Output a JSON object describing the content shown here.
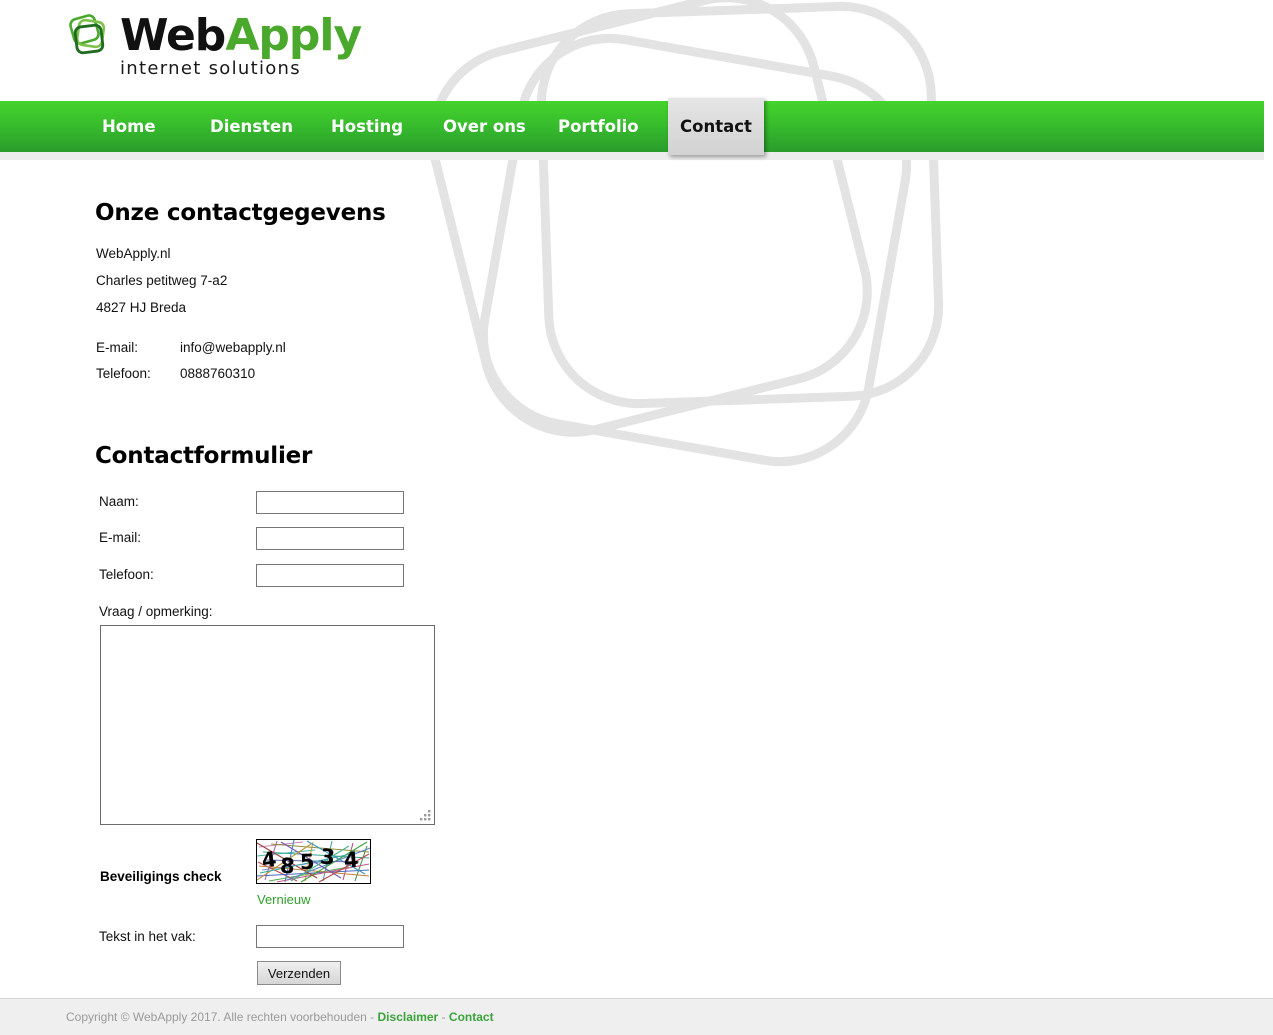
{
  "site": {
    "logo_text_part1": "Web",
    "logo_text_part2": "Apply",
    "logo_tagline": "internet solutions",
    "brand_green": "#4aa82c",
    "nav_green_top": "#44d32c",
    "nav_green_bottom": "#2a9c2c"
  },
  "nav": {
    "items": [
      {
        "label": "Home",
        "active": false
      },
      {
        "label": "Diensten",
        "active": false
      },
      {
        "label": "Hosting",
        "active": false
      },
      {
        "label": "Over ons",
        "active": false
      },
      {
        "label": "Portfolio",
        "active": false
      }
    ],
    "active_tab": "Contact"
  },
  "contact": {
    "heading": "Onze contactgegevens",
    "address_lines": [
      "WebApply.nl",
      "Charles petitweg 7-a2",
      "4827 HJ Breda"
    ],
    "details": [
      {
        "key": "E-mail:",
        "value": "info@webapply.nl"
      },
      {
        "key": "Telefoon:",
        "value": "0888760310"
      }
    ]
  },
  "form": {
    "heading": "Contactformulier",
    "fields": [
      {
        "label": "Naam:",
        "value": "",
        "placeholder": ""
      },
      {
        "label": "E-mail:",
        "value": "",
        "placeholder": ""
      },
      {
        "label": "Telefoon:",
        "value": "",
        "placeholder": ""
      }
    ],
    "message_label": "Vraag / opmerking:",
    "message_value": "",
    "message_placeholder": "",
    "captcha_label": "Beveiligings check",
    "captcha_code": "48534",
    "captcha_refresh_label": "Vernieuw",
    "captcha_input_label": "Tekst in het vak:",
    "captcha_input_value": "",
    "submit_label": "Verzenden"
  },
  "footer": {
    "copyright": "Copyright © WebApply 2017. Alle rechten voorbehouden",
    "separator": "-",
    "link_disclaimer": "Disclaimer",
    "link_contact": "Contact"
  }
}
